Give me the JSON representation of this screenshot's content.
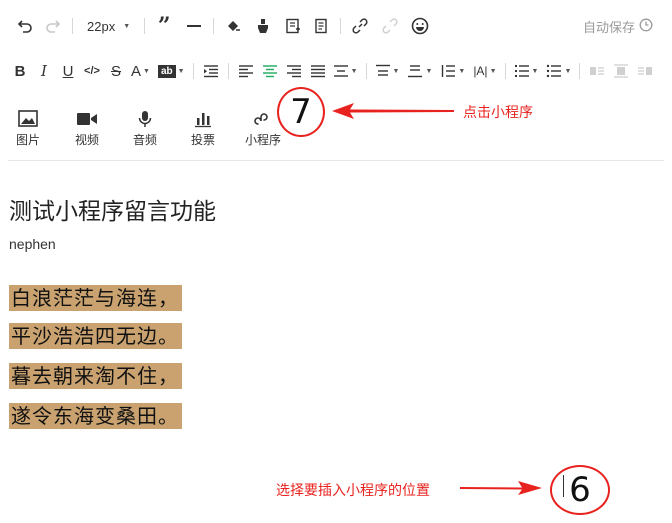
{
  "toolbar": {
    "font_size": "22px",
    "autosave_label": "自动保存"
  },
  "media": [
    {
      "key": "image",
      "label": "图片"
    },
    {
      "key": "video",
      "label": "视频"
    },
    {
      "key": "audio",
      "label": "音频"
    },
    {
      "key": "vote",
      "label": "投票"
    },
    {
      "key": "miniprogram",
      "label": "小程序"
    }
  ],
  "article": {
    "title": "测试小程序留言功能",
    "author": "nephen",
    "lines": [
      "白浪茫茫与海连，",
      "平沙浩浩四无边。",
      "暮去朝来淘不住，",
      "遂令东海变桑田。"
    ]
  },
  "annotations": {
    "step7_number": "7",
    "step7_text": "点击小程序",
    "step6_number": "6",
    "step6_text": "选择要插入小程序的位置",
    "color": "#e8231f"
  },
  "colors": {
    "highlight": "#c9a270",
    "active_align": "#2aae67"
  }
}
